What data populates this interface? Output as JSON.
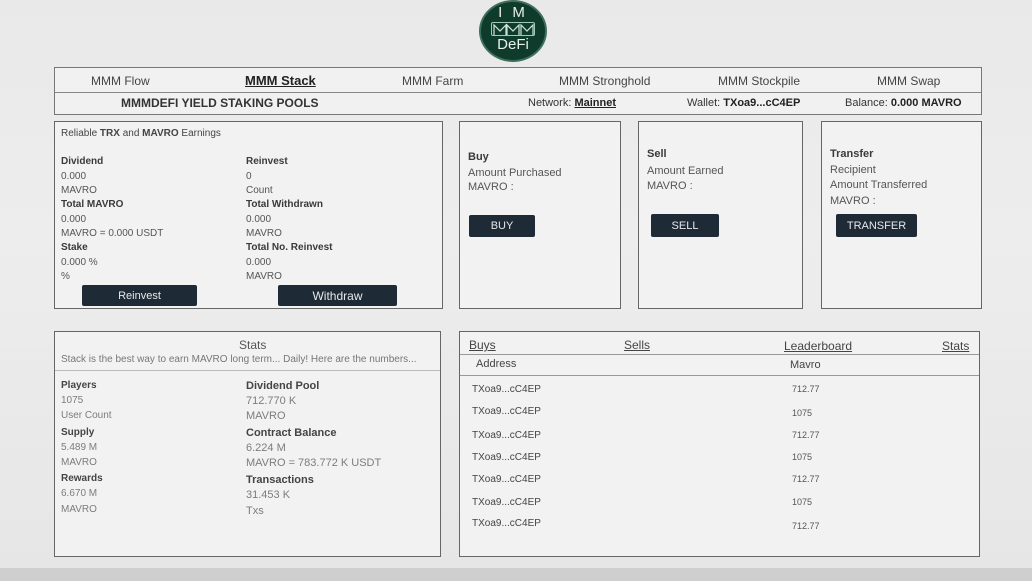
{
  "logo": {
    "line1": "I M",
    "line2": "DeFi"
  },
  "nav": {
    "tabs": [
      {
        "label": "MMM Flow"
      },
      {
        "label": "MMM Stack"
      },
      {
        "label": "MMM Farm"
      },
      {
        "label": "MMM Stronghold"
      },
      {
        "label": "MMM Stockpile"
      },
      {
        "label": "MMM Swap"
      }
    ],
    "active_tab": "MMM Stack"
  },
  "subheader": {
    "title": "MMMDEFI YIELD STAKING POOLS",
    "network_label": "Network:",
    "network_value": "Mainnet",
    "wallet_label": "Wallet:",
    "wallet_value": "TXoa9...cC4EP",
    "balance_label": "Balance:",
    "balance_value": "0.000 MAVRO"
  },
  "earnings": {
    "title_pre": "Reliable ",
    "title_trx": "TRX",
    "title_mid": " and ",
    "title_mavro": "MAVRO",
    "title_post": " Earnings",
    "dividend_label": "Dividend",
    "dividend_value": "0.000",
    "dividend_unit": "MAVRO",
    "total_mavro_label": "Total MAVRO",
    "total_mavro_value": "0.000",
    "total_mavro_unit": "MAVRO = 0.000 USDT",
    "stake_label": "Stake",
    "stake_value": "0.000 %",
    "stake_unit": "%",
    "reinvest_label": "Reinvest",
    "reinvest_value": "0",
    "reinvest_unit": "Count",
    "total_withdrawn_label": "Total Withdrawn",
    "total_withdrawn_value": "0.000",
    "total_withdrawn_unit": "MAVRO",
    "total_reinvest_label": "Total No. Reinvest",
    "total_reinvest_value": "0.000",
    "total_reinvest_unit": "MAVRO",
    "reinvest_button": "Reinvest",
    "withdraw_button": "Withdraw"
  },
  "buy": {
    "title": "Buy",
    "line1": "Amount Purchased",
    "line2": "MAVRO :",
    "button": "BUY"
  },
  "sell": {
    "title": "Sell",
    "line1": "Amount Earned",
    "line2": "MAVRO :",
    "button": "SELL"
  },
  "transfer": {
    "title": "Transfer",
    "line1": "Recipient",
    "line2": "Amount Transferred",
    "line3": "MAVRO :",
    "button": "TRANSFER"
  },
  "stats": {
    "title": "Stats",
    "subtitle": "Stack is the best way to earn MAVRO long term... Daily! Here are the numbers...",
    "players_label": "Players",
    "players_value": "1075",
    "players_unit": "User Count",
    "supply_label": "Supply",
    "supply_value": "5.489 M",
    "supply_unit": "MAVRO",
    "rewards_label": "Rewards",
    "rewards_value": "6.670 M",
    "rewards_unit": "MAVRO",
    "dividend_pool_label": "Dividend Pool",
    "dividend_pool_value": "712.770 K",
    "dividend_pool_unit": "MAVRO",
    "contract_balance_label": "Contract Balance",
    "contract_balance_value": "6.224 M",
    "contract_balance_unit": "MAVRO = 783.772 K USDT",
    "transactions_label": "Transactions",
    "transactions_value": "31.453 K",
    "transactions_unit": "Txs"
  },
  "table": {
    "tabs": [
      {
        "label": "Buys"
      },
      {
        "label": "Sells"
      },
      {
        "label": "Leaderboard"
      },
      {
        "label": "Stats"
      }
    ],
    "col_address": "Address",
    "col_mavro": "Mavro",
    "rows": [
      {
        "address": "TXoa9...cC4EP",
        "mavro": "712.77"
      },
      {
        "address": "TXoa9...cC4EP",
        "mavro": "1075"
      },
      {
        "address": "TXoa9...cC4EP",
        "mavro": "712.77"
      },
      {
        "address": "TXoa9...cC4EP",
        "mavro": "1075"
      },
      {
        "address": "TXoa9...cC4EP",
        "mavro": "712.77"
      },
      {
        "address": "TXoa9...cC4EP",
        "mavro": "1075"
      },
      {
        "address": "TXoa9...cC4EP",
        "mavro": "712.77"
      }
    ]
  }
}
